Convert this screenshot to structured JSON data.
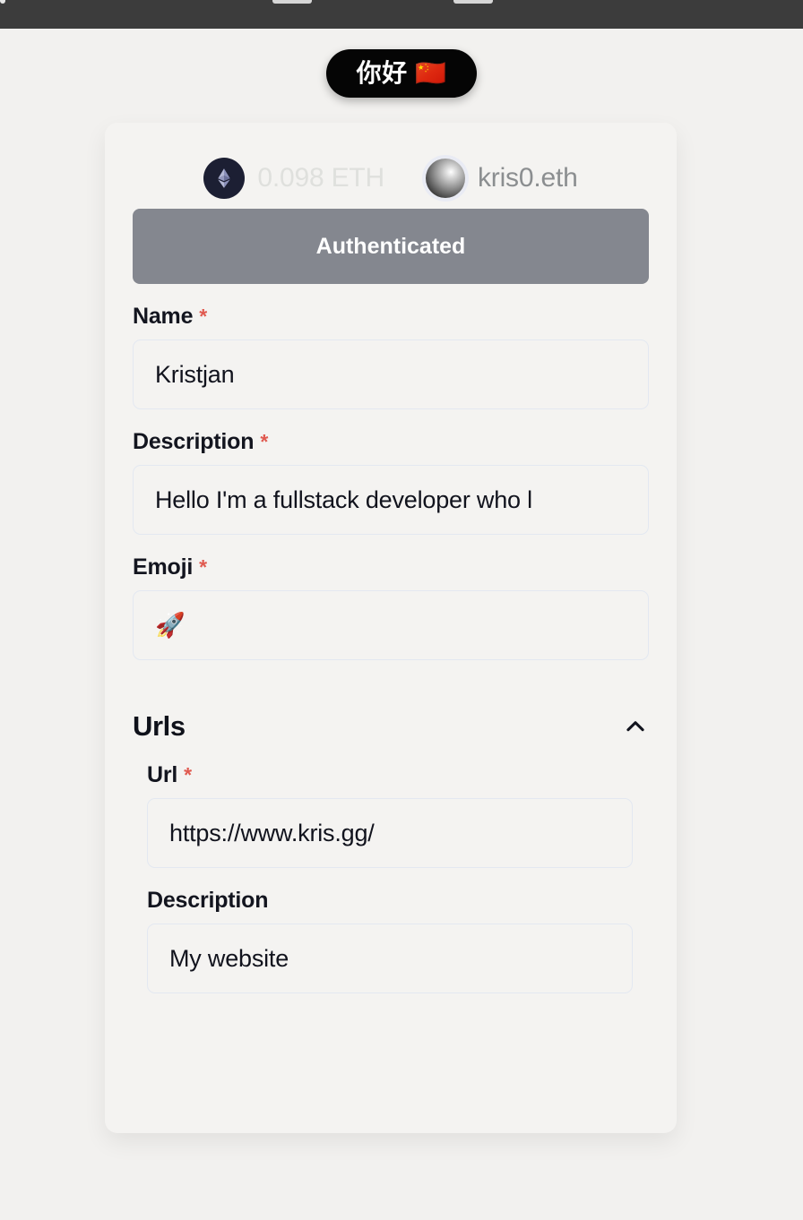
{
  "topbar": {
    "icon_name": "partial-browser-icon"
  },
  "greeting": {
    "label": "你好 🇨🇳"
  },
  "wallet": {
    "eth_icon_name": "ethereum-logo-icon",
    "balance": "0.098 ETH",
    "avatar_name": "ens-avatar",
    "ens_name": "kris0.eth",
    "balance_color": "#dfe0dd",
    "ens_color": "#8b8e90"
  },
  "auth": {
    "label": "Authenticated",
    "color": "#84878f"
  },
  "form": {
    "required_marker": "*",
    "fields": [
      {
        "label": "Name",
        "required": true,
        "value": "Kristjan"
      },
      {
        "label": "Description",
        "required": true,
        "value": "Hello I'm a fullstack developer who l"
      },
      {
        "label": "Emoji",
        "required": true,
        "value": "🚀"
      }
    ]
  },
  "urls_section": {
    "title": "Urls",
    "toggle_icon": "chevron-up-icon",
    "expanded": true,
    "fields": [
      {
        "label": "Url",
        "required": true,
        "value": "https://www.kris.gg/"
      },
      {
        "label": "Description",
        "required": false,
        "value": "My website"
      }
    ]
  },
  "colors": {
    "page_background": "#f2f1ef",
    "card_background": "#f4f3f1",
    "input_border": "#e3e8f1",
    "required_star": "#e05a50",
    "text_primary": "#13151f",
    "topbar": "#3c3c3c",
    "greeting_pill": "#050505"
  }
}
